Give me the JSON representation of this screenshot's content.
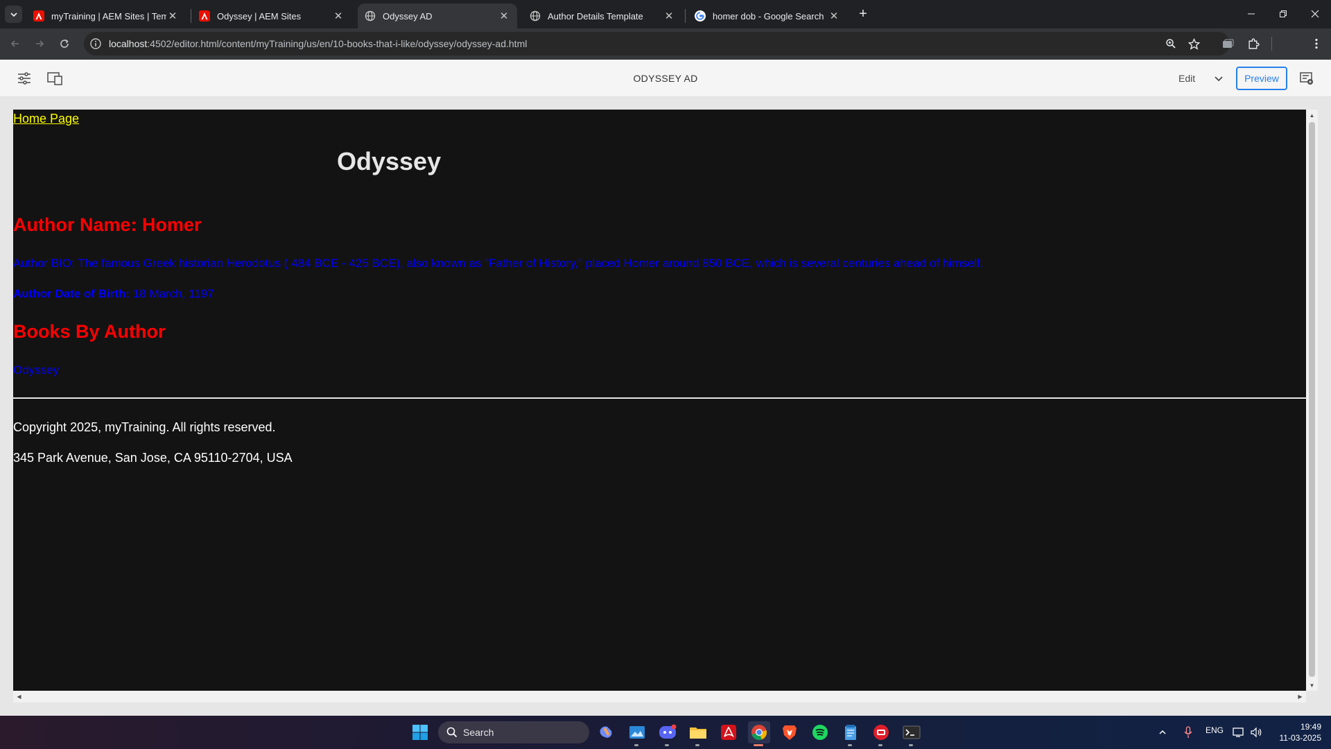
{
  "browser": {
    "tabs": [
      {
        "title": "myTraining | AEM Sites | Templa",
        "active": false,
        "favicon": "adobe-icon"
      },
      {
        "title": "Odyssey | AEM Sites",
        "active": false,
        "favicon": "adobe-icon"
      },
      {
        "title": "Odyssey AD",
        "active": true,
        "favicon": "globe-icon"
      },
      {
        "title": "Author Details Template",
        "active": false,
        "favicon": "globe-icon"
      },
      {
        "title": "homer dob - Google Search",
        "active": false,
        "favicon": "google-icon"
      }
    ],
    "url_host": "localhost",
    "url_rest": ":4502/editor.html/content/myTraining/us/en/10-books-that-i-like/odyssey/odyssey-ad.html"
  },
  "aem": {
    "page_title": "ODYSSEY AD",
    "mode_label": "Edit",
    "preview_label": "Preview"
  },
  "page": {
    "home_link": "Home Page",
    "heading": "Odyssey",
    "author_name": "Author Name: Homer",
    "author_bio": "Author BIO: The famous Greek historian Herodotus ( 484 BCE - 425 BCE), also known as \"Father of History,\" placed Homer around 850 BCE, which is several centuries ahead of himself.",
    "dob_label": "Author Date of Birth:",
    "dob_value": " 18 March, 1197",
    "books_heading": "Books By Author",
    "books": [
      "Odyssey"
    ],
    "footer_copyright": "Copyright 2025, myTraining. All rights reserved.",
    "footer_address": "345 Park Avenue, San Jose, CA 95110-2704, USA"
  },
  "taskbar": {
    "search_label": "Search",
    "language": "ENG",
    "time": "19:49",
    "date": "11-03-2025"
  },
  "colors": {
    "page_bg": "#131313",
    "home_link": "#ffff00",
    "heading_red": "#ff0000",
    "body_blue": "#0000ff",
    "preview_accent": "#2680eb"
  }
}
